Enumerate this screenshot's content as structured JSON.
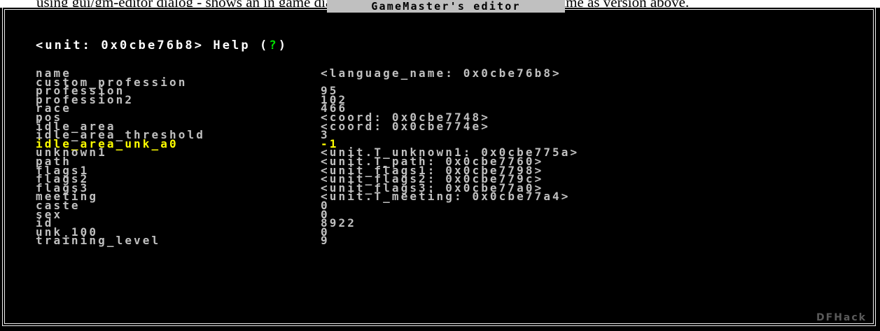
{
  "caption": "using gui/gm-editor dialog - shows an in game dialog to input lua command. Works the same as version above.",
  "window": {
    "title": "GameMaster's editor",
    "footer": "DFHack"
  },
  "header": {
    "object": "<unit: 0x0cbe76b8>",
    "help_label": "Help (",
    "help_key": "?",
    "help_close": ")"
  },
  "selected_index": 8,
  "colors": {
    "background": "#000000",
    "text": "#c0c0c0",
    "selected": "#ffff00",
    "help_key": "#00e000",
    "title_bar": "#c0c0c0"
  },
  "fields": [
    {
      "name": "name",
      "value": "<language_name: 0x0cbe76b8>"
    },
    {
      "name": "custom_profession",
      "value": ""
    },
    {
      "name": "profession",
      "value": "95"
    },
    {
      "name": "profession2",
      "value": "102"
    },
    {
      "name": "race",
      "value": "466"
    },
    {
      "name": "pos",
      "value": "<coord: 0x0cbe7748>"
    },
    {
      "name": "idle_area",
      "value": "<coord: 0x0cbe774e>"
    },
    {
      "name": "idle_area_threshold",
      "value": "3"
    },
    {
      "name": "idle_area_unk_a0",
      "value": "-1"
    },
    {
      "name": "unknown1",
      "value": "<unit.T_unknown1: 0x0cbe775a>"
    },
    {
      "name": "path",
      "value": "<unit.T_path: 0x0cbe7760>"
    },
    {
      "name": "flags1",
      "value": "<unit_flags1: 0x0cbe7798>"
    },
    {
      "name": "flags2",
      "value": "<unit_flags2: 0x0cbe779c>"
    },
    {
      "name": "flags3",
      "value": "<unit_flags3: 0x0cbe77a0>"
    },
    {
      "name": "meeting",
      "value": "<unit.T_meeting: 0x0cbe77a4>"
    },
    {
      "name": "caste",
      "value": "0"
    },
    {
      "name": "sex",
      "value": "0"
    },
    {
      "name": "id",
      "value": "8922"
    },
    {
      "name": "unk_100",
      "value": "0"
    },
    {
      "name": "training_level",
      "value": "9"
    }
  ]
}
